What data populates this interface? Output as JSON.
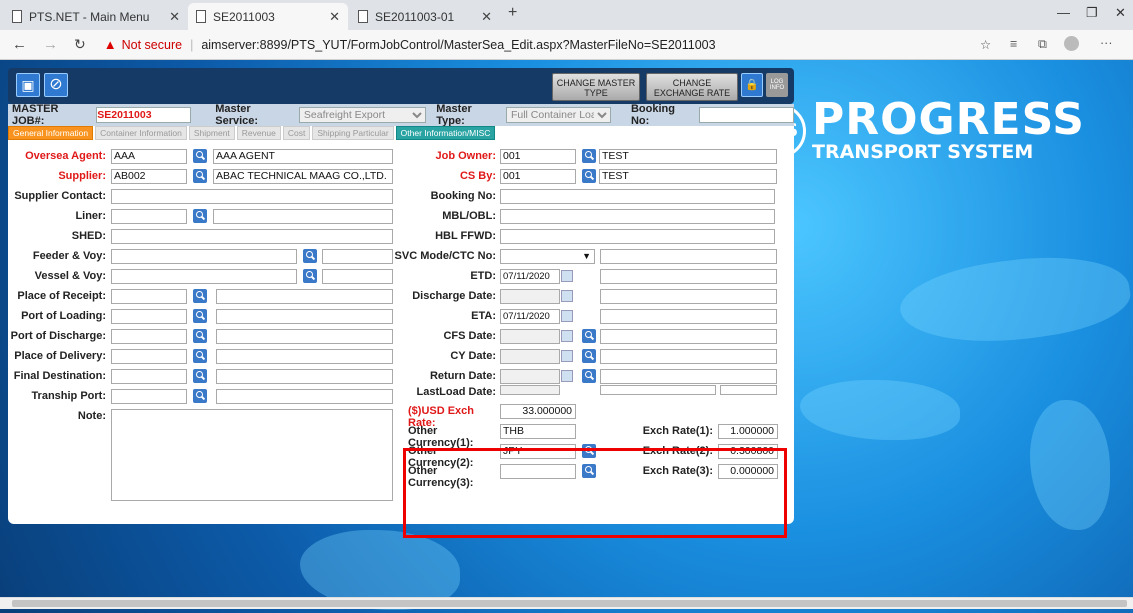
{
  "browser": {
    "tabs": [
      {
        "label": "PTS.NET - Main Menu"
      },
      {
        "label": "SE2011003"
      },
      {
        "label": "SE2011003-01"
      }
    ],
    "not_secure": "Not secure",
    "url": "aimserver:8899/PTS_YUT/FormJobControl/MasterSea_Edit.aspx?MasterFileNo=SE2011003"
  },
  "brand": {
    "title": "PROGRESS",
    "subtitle": "TRANSPORT SYSTEM",
    "logo": "PTS"
  },
  "toolbar": {
    "change_master_type": "CHANGE MASTER TYPE",
    "change_exchange_rate": "CHANGE EXCHANGE RATE",
    "log_info": "LOG INFO"
  },
  "header": {
    "master_job_label": "MASTER JOB#:",
    "master_job_value": "SE2011003",
    "master_service_label": "Master Service:",
    "master_service_value": "Seafreight Export",
    "master_type_label": "Master Type:",
    "master_type_value": "Full Container Load",
    "booking_label": "Booking No:",
    "booking_value": ""
  },
  "tabs": [
    "General Information",
    "Container Information",
    "Shipment",
    "Revenue",
    "Cost",
    "Shipping Particular",
    "Other Information/MISC"
  ],
  "left": {
    "oversea_agent": {
      "label": "Oversea Agent:",
      "code": "AAA",
      "name": "AAA AGENT"
    },
    "supplier": {
      "label": "Supplier:",
      "code": "AB002",
      "name": "ABAC TECHNICAL MAAG CO.,LTD."
    },
    "supplier_contact": "Supplier Contact:",
    "liner": "Liner:",
    "shed": "SHED:",
    "feeder": "Feeder & Voy:",
    "vessel": "Vessel & Voy:",
    "place_receipt": "Place of Receipt:",
    "port_loading": "Port of Loading:",
    "port_discharge": "Port of Discharge:",
    "place_delivery": "Place of Delivery:",
    "final_dest": "Final Destination:",
    "tranship": "Tranship Port:",
    "note": "Note:"
  },
  "right": {
    "job_owner": {
      "label": "Job Owner:",
      "code": "001",
      "name": "TEST"
    },
    "cs_by": {
      "label": "CS By:",
      "code": "001",
      "name": "TEST"
    },
    "booking_no": "Booking No:",
    "mbl": "MBL/OBL:",
    "hbl": "HBL FFWD:",
    "svc": "SVC Mode/CTC No:",
    "etd": {
      "label": "ETD:",
      "value": "07/11/2020"
    },
    "discharge_date": "Discharge Date:",
    "eta": {
      "label": "ETA:",
      "value": "07/11/2020"
    },
    "cfs_date": "CFS Date:",
    "cy_date": "CY Date:",
    "return_date": "Return Date:",
    "lastload": "LastLoad Date:"
  },
  "exchange": {
    "usd_label": "($)USD Exch Rate:",
    "usd_value": "33.000000",
    "oc1_label": "Other Currency(1):",
    "oc1_value": "THB",
    "er1_label": "Exch Rate(1):",
    "er1_value": "1.000000",
    "oc2_label": "Other Currency(2):",
    "oc2_value": "JPY",
    "er2_label": "Exch Rate(2):",
    "er2_value": "0.300800",
    "oc3_label": "Other Currency(3):",
    "oc3_value": "",
    "er3_label": "Exch Rate(3):",
    "er3_value": "0.000000"
  }
}
